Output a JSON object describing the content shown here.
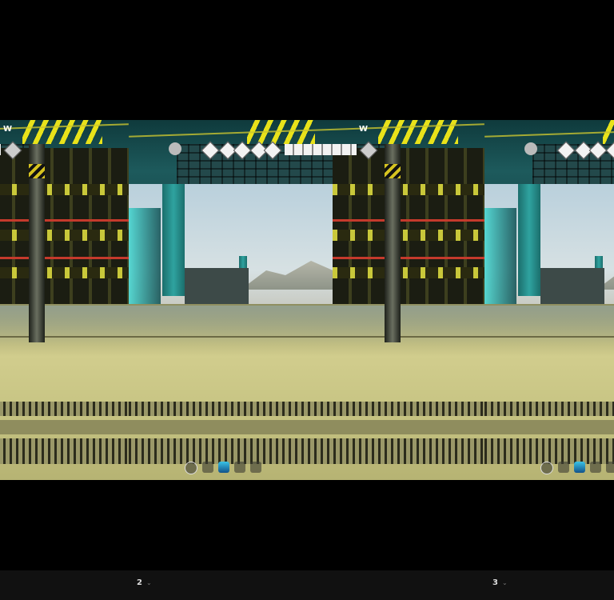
{
  "hud": {
    "compass_heading": "W"
  },
  "colors": {
    "hazard_yellow": "#e8e21a",
    "floor": "#c9c58a",
    "ceiling_teal": "#1d5a5c",
    "bottom_bar": "#111111"
  },
  "hotbar": {
    "slots": [
      "circle-icon",
      "pole-icon",
      "blue-beacon-icon",
      "foundation-icon",
      "drone-icon"
    ]
  },
  "pager": {
    "items": [
      {
        "label": "2",
        "icon": "chevron-down-icon"
      },
      {
        "label": "3",
        "icon": "chevron-down-icon"
      }
    ]
  }
}
